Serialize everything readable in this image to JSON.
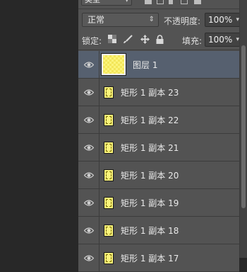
{
  "filter": {
    "kind_label": "类型"
  },
  "blend": {
    "mode": "正常",
    "opacity_label": "不透明度:",
    "opacity_value": "100%"
  },
  "lock": {
    "label": "锁定:",
    "fill_label": "填充:",
    "fill_value": "100%"
  },
  "layers": [
    {
      "name": "图层 1",
      "selected": true,
      "thumb": "large"
    },
    {
      "name": "矩形 1 副本 23"
    },
    {
      "name": "矩形 1 副本 22"
    },
    {
      "name": "矩形 1 副本 21"
    },
    {
      "name": "矩形 1 副本 20"
    },
    {
      "name": "矩形 1 副本 19"
    },
    {
      "name": "矩形 1 副本 18"
    },
    {
      "name": "矩形 1 副本 17"
    }
  ],
  "icons": {
    "visibility": "eye-icon",
    "lock_transparent": "checkerboard-icon",
    "lock_image": "brush-icon",
    "lock_position": "move-icon",
    "lock_all": "padlock-icon"
  }
}
